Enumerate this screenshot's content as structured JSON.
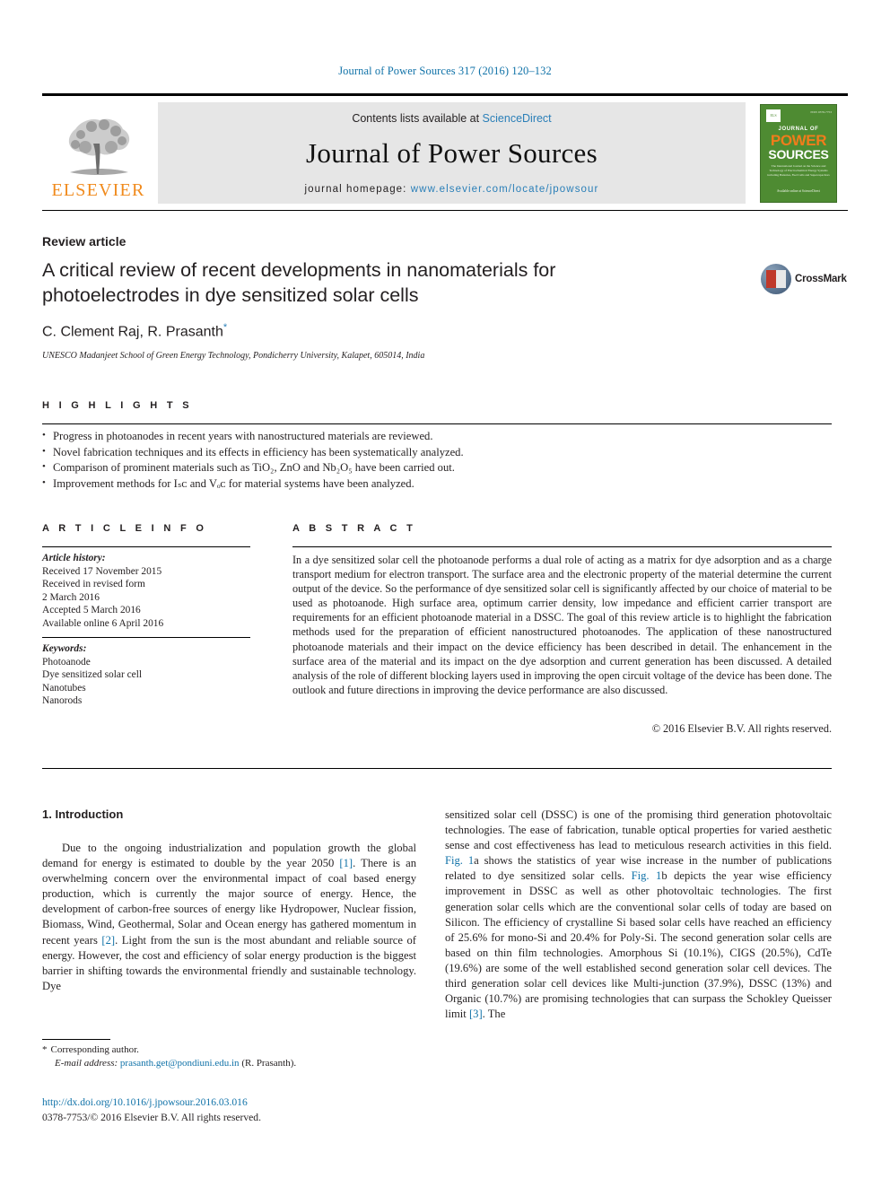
{
  "running_head": "Journal of Power Sources 317 (2016) 120–132",
  "masthead": {
    "publisher_name": "ELSEVIER",
    "contents_prefix": "Contents lists available at ",
    "contents_link": "ScienceDirect",
    "journal_title": "Journal of Power Sources",
    "homepage_prefix": "journal homepage: ",
    "homepage_url": "www.elsevier.com/locate/jpowsour",
    "cover": {
      "els_mark": "ELS",
      "top_note": "ISSN 0378-7753",
      "line1": "JOURNAL OF",
      "line2": "POWER",
      "line3": "SOURCES",
      "subtitle": "The International Journal on the Science and Technology of Electrochemical Energy Systems including Batteries, Fuel Cells and Supercapacitors",
      "footer": "Available online at\nScienceDirect"
    }
  },
  "article": {
    "type": "Review article",
    "title": "A critical review of recent developments in nanomaterials for photoelectrodes in dye sensitized solar cells",
    "authors": "C. Clement Raj, R. Prasanth",
    "corresponding_marker": "*",
    "affiliation": "UNESCO Madanjeet School of Green Energy Technology, Pondicherry University, Kalapet, 605014, India",
    "crossmark_label": "CrossMark"
  },
  "highlights": {
    "heading": "H I G H L I G H T S",
    "items": [
      "Progress in photoanodes in recent years with nanostructured materials are reviewed.",
      "Novel fabrication techniques and its effects in efficiency has been systematically analyzed.",
      "Comparison of prominent materials such as TiO₂, ZnO and Nb₂O₅ have been carried out.",
      "Improvement methods for Iₛᴄ and Vₒᴄ for material systems have been analyzed."
    ]
  },
  "article_info": {
    "heading": "A R T I C L E   I N F O",
    "history_label": "Article history:",
    "history_lines": [
      "Received 17 November 2015",
      "Received in revised form",
      "2 March 2016",
      "Accepted 5 March 2016",
      "Available online 6 April 2016"
    ],
    "keywords_label": "Keywords:",
    "keywords": [
      "Photoanode",
      "Dye sensitized solar cell",
      "Nanotubes",
      "Nanorods"
    ]
  },
  "abstract": {
    "heading": "A B S T R A C T",
    "text": "In a dye sensitized solar cell the photoanode performs a dual role of acting as a matrix for dye adsorption and as a charge transport medium for electron transport. The surface area and the electronic property of the material determine the current output of the device. So the performance of dye sensitized solar cell is significantly affected by our choice of material to be used as photoanode. High surface area, optimum carrier density, low impedance and efficient carrier transport are requirements for an efficient photoanode material in a DSSC. The goal of this review article is to highlight the fabrication methods used for the preparation of efficient nanostructured photoanodes. The application of these nanostructured photoanode materials and their impact on the device efficiency has been described in detail. The enhancement in the surface area of the material and its impact on the dye adsorption and current generation has been discussed. A detailed analysis of the role of different blocking layers used in improving the open circuit voltage of the device has been done. The outlook and future directions in improving the device performance are also discussed.",
    "copyright": "© 2016 Elsevier B.V. All rights reserved."
  },
  "body": {
    "section_number_title": "1. Introduction",
    "left_paragraph_part1": "Due to the ongoing industrialization and population growth the global demand for energy is estimated to double by the year 2050 ",
    "ref1": "[1]",
    "left_paragraph_part2": ". There is an overwhelming concern over the environmental impact of coal based energy production, which is currently the major source of energy. Hence, the development of carbon-free sources of energy like Hydropower, Nuclear fission, Biomass, Wind, Geothermal, Solar and Ocean energy has gathered momentum in recent years ",
    "ref2": "[2]",
    "left_paragraph_part3": ". Light from the sun is the most abundant and reliable source of energy. However, the cost and efficiency of solar energy production is the biggest barrier in shifting towards the environmental friendly and sustainable technology. Dye",
    "right_paragraph_part1": "sensitized solar cell (DSSC) is one of the promising third generation photovoltaic technologies. The ease of fabrication, tunable optical properties for varied aesthetic sense and cost effectiveness has lead to meticulous research activities in this field. ",
    "figref1a": "Fig. 1",
    "right_paragraph_part2": "a shows the statistics of year wise increase in the number of publications related to dye sensitized solar cells. ",
    "figref1b": "Fig. 1",
    "right_paragraph_part3": "b depicts the year wise efficiency improvement in DSSC as well as other photovoltaic technologies. The first generation solar cells which are the conventional solar cells of today are based on Silicon. The efficiency of crystalline Si based solar cells have reached an efficiency of 25.6% for mono-Si and 20.4% for Poly-Si. The second generation solar cells are based on thin film technologies. Amorphous Si (10.1%), CIGS (20.5%), CdTe (19.6%) are some of the well established second generation solar cell devices. The third generation solar cell devices like Multi-junction (37.9%), DSSC (13%) and Organic (10.7%) are promising technologies that can surpass the Schokley Queisser limit ",
    "ref3": "[3]",
    "right_paragraph_part4": ". The"
  },
  "footer": {
    "corresponding_star": "*",
    "corresponding_label": "Corresponding author.",
    "email_label": "E-mail address:",
    "email": "prasanth.get@pondiuni.edu.in",
    "email_owner": "(R. Prasanth).",
    "doi": "http://dx.doi.org/10.1016/j.jpowsour.2016.03.016",
    "issn_line": "0378-7753/© 2016 Elsevier B.V. All rights reserved."
  },
  "colors": {
    "link": "#1072a8",
    "science_direct": "#2a7fb8",
    "elsevier_orange": "#f08a1c",
    "cover_green": "#4e8b32"
  }
}
